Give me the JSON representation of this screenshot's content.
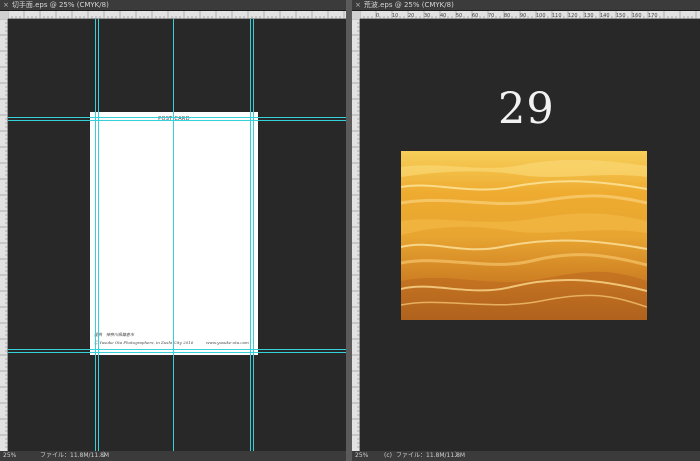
{
  "left_doc": {
    "tab_title": "切手面.eps @ 25% (CMYK/8)",
    "close_glyph": "×",
    "zoom": "25%",
    "file_info": "ファイル：11.8M/11.8M",
    "status_arrow": "〉",
    "postcard": {
      "title": "POST CARD",
      "caption_line1": "提供　神奈川県鎌倉市",
      "caption_line2": "Ⓒ Yusuke Ota Photographers, in Zushi City 2016",
      "url": "www.yusuke-ota.com"
    }
  },
  "right_doc": {
    "tab_title": "荒波.eps @ 25% (CMYK/8)",
    "close_glyph": "×",
    "zoom": "25%",
    "status_prefix": "(c) ",
    "file_info": "ファイル：11.8M/11.8M",
    "status_arrow": "〉",
    "page_number": "29"
  },
  "rulers": {
    "right_top_labels": [
      "0",
      "10",
      "20",
      "30",
      "40",
      "50",
      "60",
      "70",
      "80",
      "90",
      "100",
      "110",
      "120",
      "130",
      "140",
      "150",
      "160",
      "170"
    ]
  },
  "colors": {
    "guide": "#35d0d8",
    "canvas_bg": "#282828"
  }
}
